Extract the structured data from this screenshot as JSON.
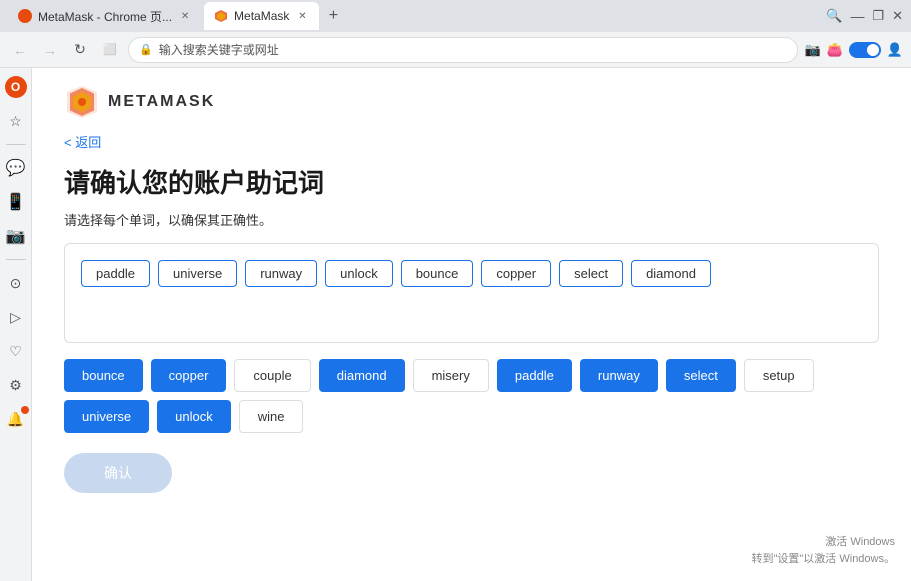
{
  "browser": {
    "tabs": [
      {
        "id": "tab1",
        "title": "MetaMask - Chrome 页...",
        "icon": "opera",
        "active": false
      },
      {
        "id": "tab2",
        "title": "MetaMask",
        "icon": "metamask",
        "active": true
      }
    ],
    "newTabLabel": "+",
    "addressBar": {
      "placeholder": "输入搜索关键字或网址",
      "value": ""
    },
    "controls": {
      "minimize": "—",
      "restore": "❐",
      "close": "✕"
    }
  },
  "sidebar": {
    "icons": [
      {
        "id": "opera",
        "symbol": "O",
        "label": "opera-icon"
      },
      {
        "id": "star",
        "symbol": "☆",
        "label": "bookmark-icon"
      },
      {
        "id": "messenger",
        "symbol": "💬",
        "label": "messenger-icon"
      },
      {
        "id": "phone",
        "symbol": "📱",
        "label": "whatsapp-icon"
      },
      {
        "id": "instagram",
        "symbol": "📷",
        "label": "instagram-icon"
      },
      {
        "id": "divider",
        "symbol": "",
        "label": "divider"
      },
      {
        "id": "clock",
        "symbol": "⊙",
        "label": "history-icon"
      },
      {
        "id": "arrow",
        "symbol": "▷",
        "label": "continue-icon"
      },
      {
        "id": "heart",
        "symbol": "♡",
        "label": "heart-icon"
      },
      {
        "id": "gear",
        "symbol": "⚙",
        "label": "settings-icon"
      },
      {
        "id": "bell",
        "symbol": "🔔",
        "label": "notification-icon",
        "badge": true
      }
    ]
  },
  "metamask": {
    "logo_text": "METAMASK",
    "back_label": "< 返回",
    "heading": "请确认您的账户助记词",
    "subtext": "请选择每个单词，以确保其正确性。",
    "confirm_button_label": "确认",
    "selection_area": {
      "chips": [
        {
          "id": "chip1",
          "label": "paddle"
        },
        {
          "id": "chip2",
          "label": "universe"
        },
        {
          "id": "chip3",
          "label": "runway"
        },
        {
          "id": "chip4",
          "label": "unlock"
        },
        {
          "id": "chip5",
          "label": "bounce"
        },
        {
          "id": "chip6",
          "label": "copper"
        },
        {
          "id": "chip7",
          "label": "select"
        },
        {
          "id": "chip8",
          "label": "diamond"
        }
      ]
    },
    "word_bank": [
      {
        "id": "w1",
        "label": "bounce",
        "style": "blue"
      },
      {
        "id": "w2",
        "label": "copper",
        "style": "blue"
      },
      {
        "id": "w3",
        "label": "couple",
        "style": "white"
      },
      {
        "id": "w4",
        "label": "diamond",
        "style": "blue"
      },
      {
        "id": "w5",
        "label": "misery",
        "style": "white"
      },
      {
        "id": "w6",
        "label": "paddle",
        "style": "blue"
      },
      {
        "id": "w7",
        "label": "runway",
        "style": "blue"
      },
      {
        "id": "w8",
        "label": "select",
        "style": "blue"
      },
      {
        "id": "w9",
        "label": "setup",
        "style": "white"
      },
      {
        "id": "w10",
        "label": "universe",
        "style": "blue"
      },
      {
        "id": "w11",
        "label": "unlock",
        "style": "blue"
      },
      {
        "id": "w12",
        "label": "wine",
        "style": "white"
      }
    ]
  },
  "watermark": {
    "line1": "激活 Windows",
    "line2": "转到\"设置\"以激活 Windows。"
  }
}
